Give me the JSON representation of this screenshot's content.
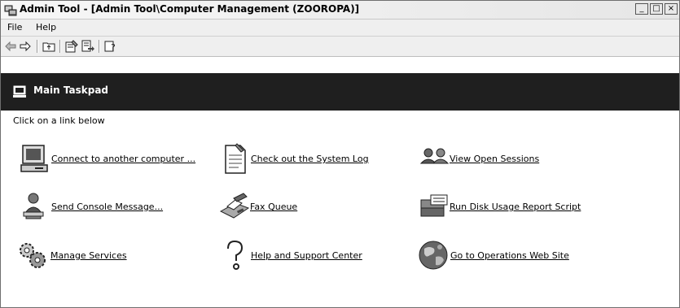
{
  "window": {
    "title": "Admin Tool - [Admin Tool\\Computer Management (ZOOROPA)]",
    "controls": {
      "minimize": "_",
      "restore": "□",
      "close": "×"
    }
  },
  "menu": {
    "file": "File",
    "help": "Help"
  },
  "toolbar": {
    "icons": [
      "back-arrow-icon",
      "forward-arrow-icon",
      "up-folder-icon",
      "properties-icon",
      "export-list-icon",
      "help-icon"
    ]
  },
  "taskpad": {
    "title": "Main Taskpad",
    "instructions": "Click on a link below",
    "tasks": [
      {
        "label": "Connect to another computer ...",
        "icon": "computer-icon"
      },
      {
        "label": "Check out the System Log",
        "icon": "document-icon"
      },
      {
        "label": "View Open Sessions",
        "icon": "users-icon"
      },
      {
        "label": "Send Console Message...",
        "icon": "user-message-icon"
      },
      {
        "label": "Fax Queue",
        "icon": "fax-icon"
      },
      {
        "label": "Run Disk Usage Report Script",
        "icon": "disk-script-icon"
      },
      {
        "label": "Manage Services",
        "icon": "gears-icon"
      },
      {
        "label": "Help and Support Center",
        "icon": "question-icon"
      },
      {
        "label": "Go to Operations Web Site",
        "icon": "globe-icon"
      }
    ]
  }
}
